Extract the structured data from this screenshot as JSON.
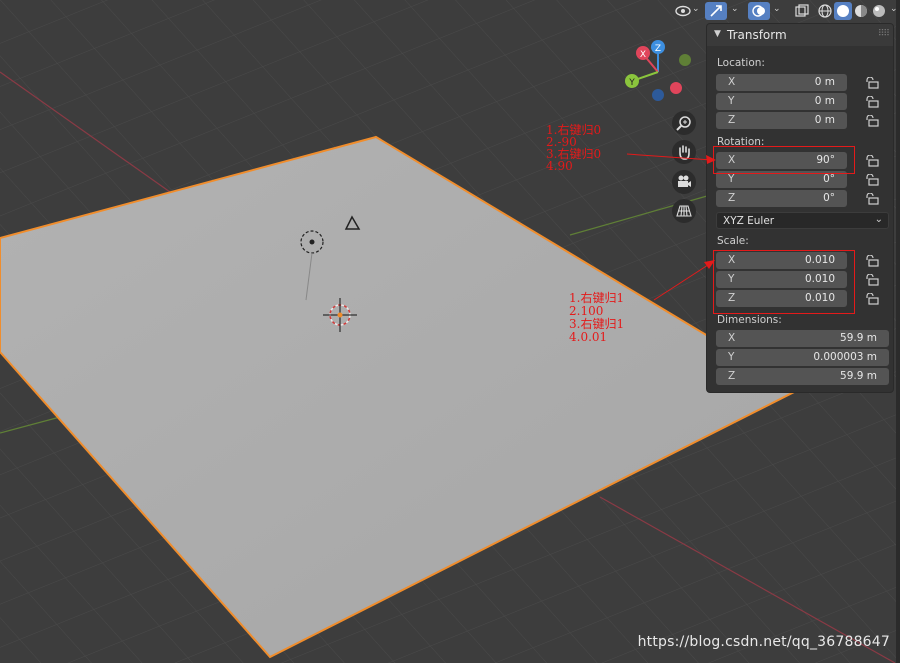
{
  "header": {
    "icons": [
      "eye-icon",
      "gizmo-icon",
      "overlay-icon",
      "xray-icon",
      "shading-wireframe-icon",
      "shading-solid-icon",
      "shading-material-icon",
      "shading-rendered-icon"
    ]
  },
  "panel": {
    "title": "Transform",
    "location": {
      "label": "Location:",
      "fields": [
        {
          "axis": "X",
          "value": "0 m"
        },
        {
          "axis": "Y",
          "value": "0 m"
        },
        {
          "axis": "Z",
          "value": "0 m"
        }
      ]
    },
    "rotation": {
      "label": "Rotation:",
      "fields": [
        {
          "axis": "X",
          "value": "90°"
        },
        {
          "axis": "Y",
          "value": "0°"
        },
        {
          "axis": "Z",
          "value": "0°"
        }
      ],
      "mode": "XYZ Euler"
    },
    "scale": {
      "label": "Scale:",
      "fields": [
        {
          "axis": "X",
          "value": "0.010"
        },
        {
          "axis": "Y",
          "value": "0.010"
        },
        {
          "axis": "Z",
          "value": "0.010"
        }
      ]
    },
    "dimensions": {
      "label": "Dimensions:",
      "fields": [
        {
          "axis": "X",
          "value": "59.9 m"
        },
        {
          "axis": "Y",
          "value": "0.000003 m"
        },
        {
          "axis": "Z",
          "value": "59.9 m"
        }
      ]
    }
  },
  "gizmo": {
    "axes": [
      {
        "label": "X",
        "color": "#e0455b"
      },
      {
        "label": "Y",
        "color": "#8bc53d"
      },
      {
        "label": "Z",
        "color": "#3d8fe0"
      }
    ]
  },
  "annotations": {
    "rotation_steps": [
      "1.右键归0",
      "2.-90",
      "3.右键归0",
      "4.90"
    ],
    "scale_steps": [
      "1.右键归1",
      "2.100",
      "3.右键归1",
      "4.0.01"
    ]
  },
  "watermark": "https://blog.csdn.net/qq_36788647",
  "colors": {
    "viewport_bg": "#3d3d3d",
    "plane_fill": "#a9a9a9",
    "selection_outline": "#f08d2c",
    "annotation": "#e41a1a",
    "accent": "#5680c2"
  }
}
